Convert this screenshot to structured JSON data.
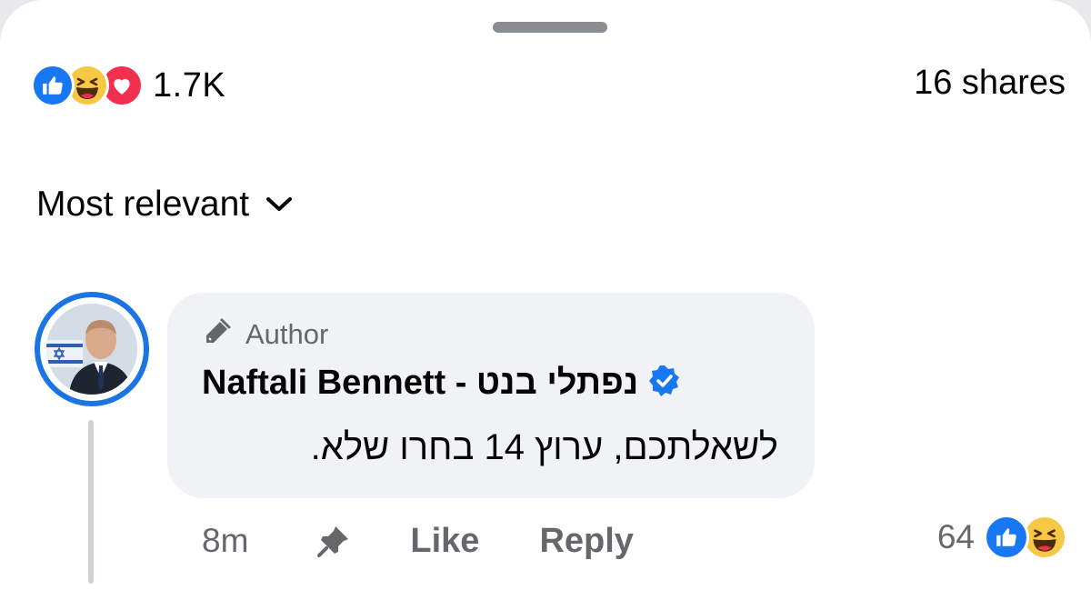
{
  "colors": {
    "accent": "#1b74e4",
    "like_blue": "#1877f2",
    "haha_yellow": "#f7c844",
    "love_red": "#f0304e",
    "secondary_text": "#65676b",
    "bubble_bg": "#f0f2f5"
  },
  "summary": {
    "reaction_icons": [
      "like-icon",
      "haha-icon",
      "love-icon"
    ],
    "reaction_count": "1.7K",
    "shares": "16 shares"
  },
  "sort": {
    "label": "Most relevant",
    "icon": "chevron-down-icon"
  },
  "comment": {
    "author_badge": "Author",
    "author_badge_icon": "pen-icon",
    "name": "Naftali Bennett - נפתלי בנט",
    "verified_icon": "verified-badge-icon",
    "text": "לשאלתכם, ערוץ 14 בחרו שלא.",
    "time": "8m",
    "pin_icon": "pin-icon",
    "like_label": "Like",
    "reply_label": "Reply",
    "reaction_count": "64",
    "reaction_icons": [
      "like-icon",
      "haha-icon"
    ]
  }
}
